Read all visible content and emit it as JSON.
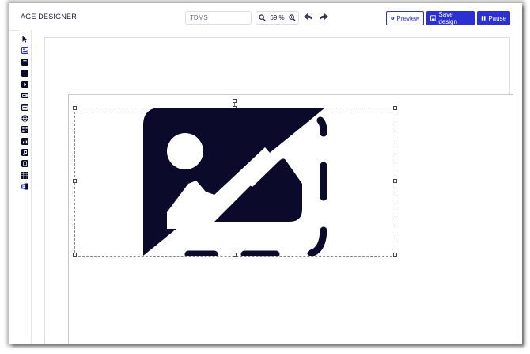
{
  "header": {
    "app_title": "AGE DESIGNER",
    "doc_name": "TDMS",
    "zoom_level": "69 %",
    "preview_label": "Preview",
    "save_label": "Save design",
    "pause_label": "Pause"
  },
  "toolbar": {
    "tools": [
      {
        "name": "select-tool",
        "icon": "cursor-arrow-icon"
      },
      {
        "name": "image-tool",
        "icon": "image-icon",
        "active": true
      },
      {
        "name": "text-tool",
        "icon": "text-icon"
      },
      {
        "name": "shape-tool",
        "icon": "square-icon"
      },
      {
        "name": "video-tool",
        "icon": "video-icon"
      },
      {
        "name": "ticker-tool",
        "icon": "ticker-icon"
      },
      {
        "name": "datetime-tool",
        "icon": "calendar-icon"
      },
      {
        "name": "web-tool",
        "icon": "globe-icon"
      },
      {
        "name": "qr-tool",
        "icon": "qr-code-icon"
      },
      {
        "name": "chart-tool",
        "icon": "bar-chart-icon"
      },
      {
        "name": "audio-tool",
        "icon": "music-icon"
      },
      {
        "name": "device-tool",
        "icon": "device-icon"
      },
      {
        "name": "grid-tool",
        "icon": "grid-icon"
      },
      {
        "name": "powerpoint-tool",
        "icon": "powerpoint-icon"
      }
    ]
  },
  "colors": {
    "accent": "#2c2fd1",
    "icon_dark": "#0c0a2a"
  }
}
